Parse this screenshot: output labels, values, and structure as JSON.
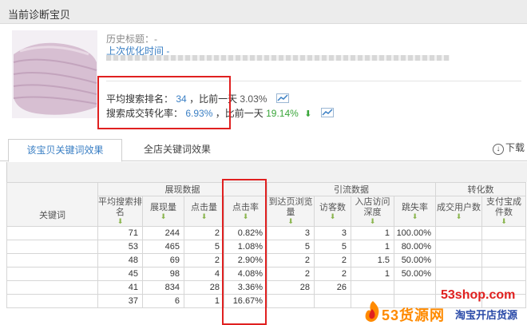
{
  "header": {
    "title": "当前诊断宝贝"
  },
  "product": {
    "history_title": "历史标题：-",
    "last_optimized": "上次优化时间 -"
  },
  "metrics": {
    "avg_rank_label": "平均搜索排名：",
    "avg_rank_value": "34",
    "avg_rank_compare": "，比前一天",
    "avg_rank_change": "3.03%",
    "conv_label": "搜索成交转化率：",
    "conv_value": "6.93%",
    "conv_compare": "，比前一天",
    "conv_change": "19.14%"
  },
  "colors": {
    "accent": "#3a7fc4",
    "highlight": "#e02020",
    "positive": "#3aa63a"
  },
  "tabs": [
    {
      "label": "该宝贝关键词效果",
      "active": true
    },
    {
      "label": "全店关键词效果",
      "active": false
    }
  ],
  "download_label": "下载",
  "table": {
    "keyword_header": "关键词",
    "groups": [
      "展现数据",
      "引流数据",
      "转化数"
    ],
    "columns": [
      "平均搜索排名",
      "展现量",
      "点击量",
      "点击率",
      "到达页浏览量",
      "访客数",
      "入店访问深度",
      "跳失率",
      "成交用户数",
      "支付宝成件数"
    ],
    "rows": [
      [
        "71",
        "244",
        "2",
        "0.82%",
        "3",
        "3",
        "1",
        "100.00%",
        "",
        ""
      ],
      [
        "53",
        "465",
        "5",
        "1.08%",
        "5",
        "5",
        "1",
        "80.00%",
        "",
        ""
      ],
      [
        "48",
        "69",
        "2",
        "2.90%",
        "2",
        "2",
        "1.5",
        "50.00%",
        "",
        ""
      ],
      [
        "45",
        "98",
        "4",
        "4.08%",
        "2",
        "2",
        "1",
        "50.00%",
        "",
        ""
      ],
      [
        "41",
        "834",
        "28",
        "3.36%",
        "28",
        "26",
        "",
        "",
        "",
        ""
      ],
      [
        "37",
        "6",
        "1",
        "16.67%",
        "",
        "",
        "",
        "",
        "",
        ""
      ]
    ]
  },
  "watermark": {
    "site": "53shop.com",
    "brand": "53货源网",
    "tagline": "淘宝开店货源"
  }
}
